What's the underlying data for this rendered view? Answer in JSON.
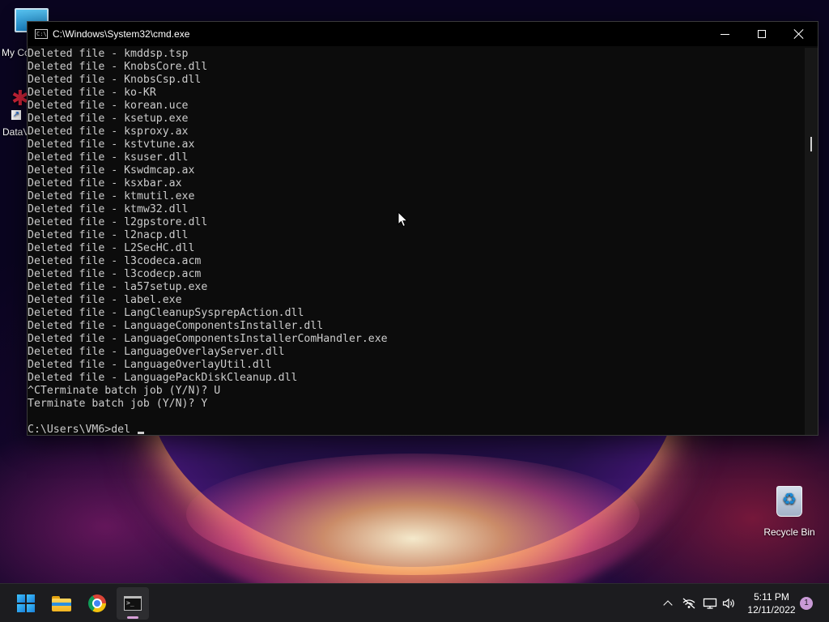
{
  "desktop": {
    "icons": [
      {
        "label": "My Co",
        "icon": "computer-icon"
      },
      {
        "label": "DataV",
        "icon": "app-shortcut-icon"
      },
      {
        "label": "Recycle Bin",
        "icon": "recycle-bin-icon"
      }
    ]
  },
  "cmd": {
    "title": "C:\\Windows\\System32\\cmd.exe",
    "icon_glyph": "C:\\",
    "lines": [
      "Deleted file - kmddsp.tsp",
      "Deleted file - KnobsCore.dll",
      "Deleted file - KnobsCsp.dll",
      "Deleted file - ko-KR",
      "Deleted file - korean.uce",
      "Deleted file - ksetup.exe",
      "Deleted file - ksproxy.ax",
      "Deleted file - kstvtune.ax",
      "Deleted file - ksuser.dll",
      "Deleted file - Kswdmcap.ax",
      "Deleted file - ksxbar.ax",
      "Deleted file - ktmutil.exe",
      "Deleted file - ktmw32.dll",
      "Deleted file - l2gpstore.dll",
      "Deleted file - l2nacp.dll",
      "Deleted file - L2SecHC.dll",
      "Deleted file - l3codeca.acm",
      "Deleted file - l3codecp.acm",
      "Deleted file - la57setup.exe",
      "Deleted file - label.exe",
      "Deleted file - LangCleanupSysprepAction.dll",
      "Deleted file - LanguageComponentsInstaller.dll",
      "Deleted file - LanguageComponentsInstallerComHandler.exe",
      "Deleted file - LanguageOverlayServer.dll",
      "Deleted file - LanguageOverlayUtil.dll",
      "Deleted file - LanguagePackDiskCleanup.dll",
      "^CTerminate batch job (Y/N)? U",
      "Terminate batch job (Y/N)? Y",
      ""
    ],
    "prompt": "C:\\Users\\VM6>",
    "input": "del "
  },
  "taskbar": {
    "apps": [
      {
        "name": "Start",
        "icon": "windows-logo-icon"
      },
      {
        "name": "File Explorer",
        "icon": "folder-icon"
      },
      {
        "name": "Google Chrome",
        "icon": "chrome-icon"
      },
      {
        "name": "Command Prompt",
        "icon": "terminal-icon",
        "active": true
      }
    ],
    "term_glyph": ">_",
    "clock_time": "5:11 PM",
    "clock_date": "12/11/2022",
    "notification_count": "1"
  },
  "colors": {
    "console_bg": "#0c0c0c",
    "console_text": "#cccccc",
    "taskbar_bg": "#1c1c1f",
    "notif_badge": "#c99ad6"
  }
}
